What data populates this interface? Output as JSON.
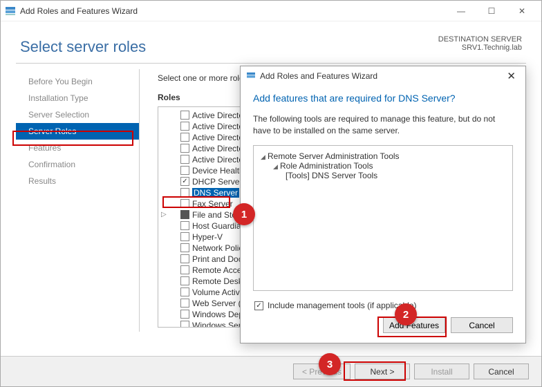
{
  "outer": {
    "title": "Add Roles and Features Wizard",
    "page_title": "Select server roles",
    "dest_label": "DESTINATION SERVER",
    "dest_server": "SRV1.Technig.lab"
  },
  "sidebar": {
    "items": [
      {
        "label": "Before You Begin"
      },
      {
        "label": "Installation Type"
      },
      {
        "label": "Server Selection"
      },
      {
        "label": "Server Roles"
      },
      {
        "label": "Features"
      },
      {
        "label": "Confirmation"
      },
      {
        "label": "Results"
      }
    ]
  },
  "pane": {
    "instruction": "Select one or more roles",
    "roles_label": "Roles",
    "roles": [
      {
        "label": "Active Directory"
      },
      {
        "label": "Active Directory"
      },
      {
        "label": "Active Directory"
      },
      {
        "label": "Active Directory"
      },
      {
        "label": "Active Directory"
      },
      {
        "label": "Device Health At"
      },
      {
        "label": "DHCP Server (Ins",
        "checked": true
      },
      {
        "label": "DNS Server",
        "selected": true
      },
      {
        "label": "Fax Server"
      },
      {
        "label": "File and Storage",
        "exp": true,
        "partial": true
      },
      {
        "label": "Host Guardian S"
      },
      {
        "label": "Hyper-V"
      },
      {
        "label": "Network Policy a"
      },
      {
        "label": "Print and Docum"
      },
      {
        "label": "Remote Access"
      },
      {
        "label": "Remote Desktop"
      },
      {
        "label": "Volume Activatio"
      },
      {
        "label": "Web Server (IIS)"
      },
      {
        "label": "Windows Deploy"
      },
      {
        "label": "Windows Server"
      }
    ]
  },
  "footer": {
    "prev": "< Previous",
    "next": "Next >",
    "install": "Install",
    "cancel": "Cancel"
  },
  "overlay": {
    "title": "Add Roles and Features Wizard",
    "heading": "Add features that are required for DNS Server?",
    "body": "The following tools are required to manage this feature, but do not have to be installed on the same server.",
    "tree": {
      "l0": "Remote Server Administration Tools",
      "l1": "Role Administration Tools",
      "l2": "[Tools] DNS Server Tools"
    },
    "include": "Include management tools (if applicable)",
    "add": "Add Features",
    "cancel": "Cancel"
  },
  "markers": {
    "c1": "1",
    "c2": "2",
    "c3": "3"
  }
}
